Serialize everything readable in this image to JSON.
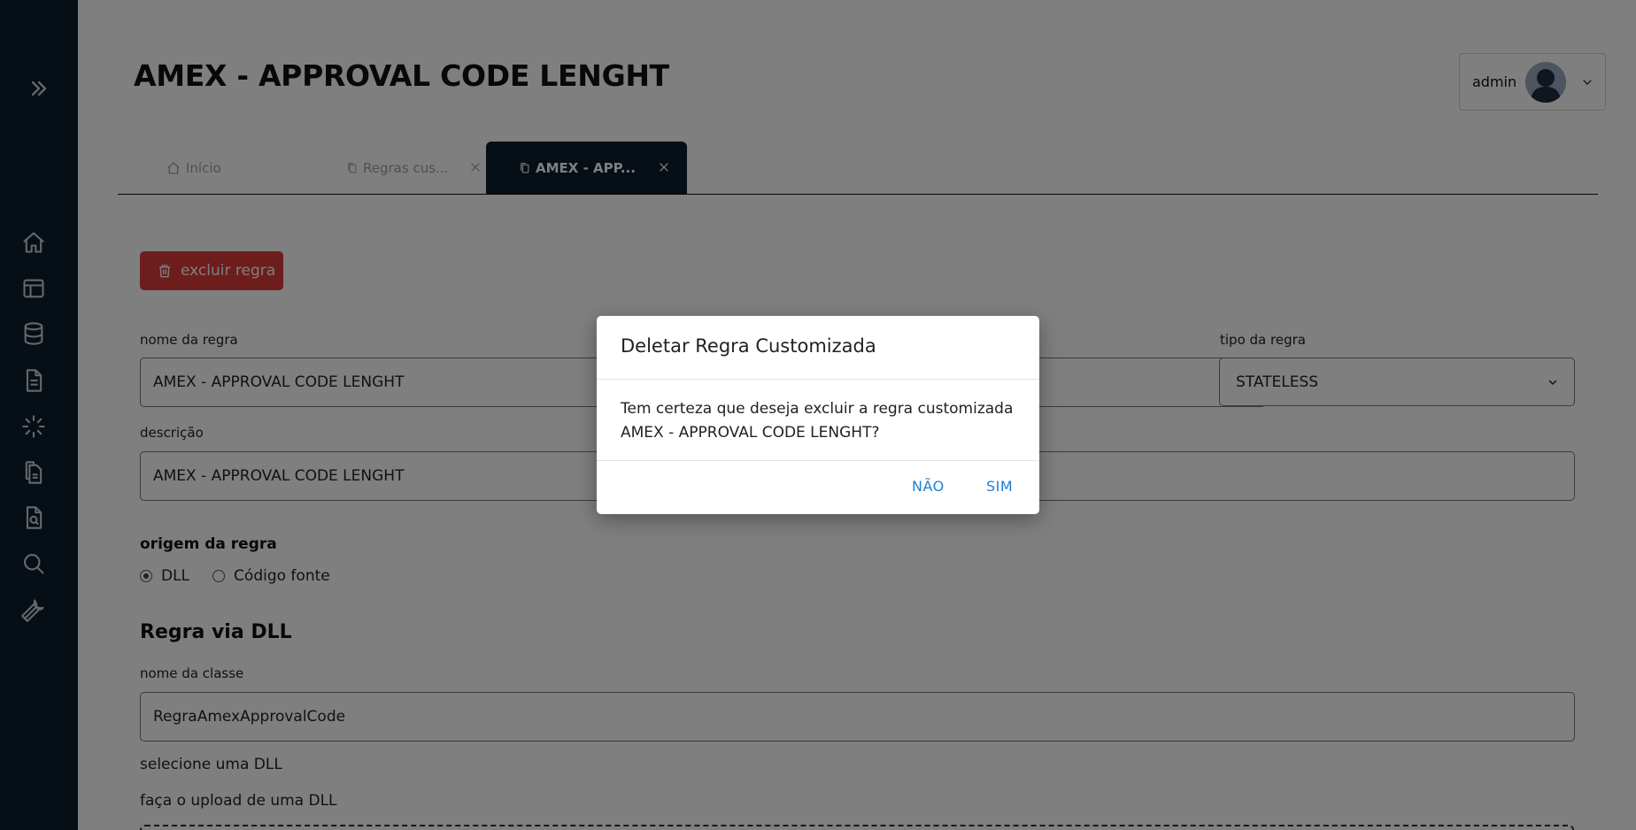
{
  "page": {
    "title": "AMEX - APPROVAL CODE LENGHT"
  },
  "user": {
    "name": "admin"
  },
  "tabs": [
    {
      "label": "Início",
      "icon": "home-icon",
      "closable": false,
      "active": false
    },
    {
      "label": "Regras cus...",
      "icon": "copy-icon",
      "closable": true,
      "active": false
    },
    {
      "label": "AMEX - APP...",
      "icon": "copy-icon",
      "closable": true,
      "active": true
    }
  ],
  "sidebar": {
    "toggle_icon": "double-chevron-right-icon",
    "items": [
      {
        "icon": "home-icon"
      },
      {
        "icon": "layout-icon"
      },
      {
        "icon": "database-icon"
      },
      {
        "icon": "file-text-icon"
      },
      {
        "icon": "loader-icon"
      },
      {
        "icon": "files-icon"
      },
      {
        "icon": "file-search-icon"
      },
      {
        "icon": "search-icon"
      },
      {
        "icon": "wrench-icon"
      }
    ]
  },
  "form": {
    "delete_label": "excluir regra",
    "rule_name_label": "nome da regra",
    "rule_name_value": "AMEX - APPROVAL CODE LENGHT",
    "rule_type_label": "tipo da regra",
    "rule_type_value": "STATELESS",
    "description_label": "descrição",
    "description_value": "AMEX - APPROVAL CODE LENGHT",
    "origin_label": "origem da regra",
    "origin_options": [
      "DLL",
      "Código fonte"
    ],
    "origin_selected": "DLL",
    "dll_section_title": "Regra via DLL",
    "class_name_label": "nome da classe",
    "class_name_value": "RegraAmexApprovalCode",
    "select_dll_label": "selecione uma DLL",
    "upload_dll_label": "faça o upload de uma DLL"
  },
  "modal": {
    "title": "Deletar Regra Customizada",
    "body": "Tem certeza que deseja excluir a regra customizada AMEX - APPROVAL CODE LENGHT?",
    "cancel_label": "NÃO",
    "confirm_label": "SIM"
  },
  "colors": {
    "sidebar_bg": "#0f1e2d",
    "danger": "#dc3b3b",
    "link": "#1d7fd1"
  }
}
